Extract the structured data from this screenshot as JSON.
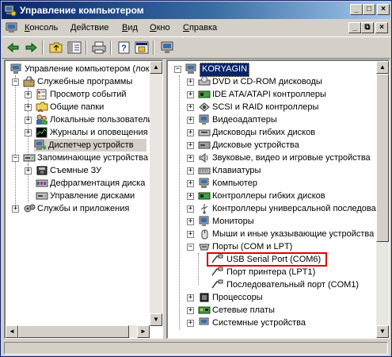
{
  "window": {
    "title": "Управление компьютером",
    "controls": {
      "minimize": "_",
      "maximize": "□",
      "close": "×"
    }
  },
  "menu": {
    "items": [
      {
        "label": "Консоль",
        "underline": "К",
        "rest": "онсоль"
      },
      {
        "label": "Действие",
        "underline": "Д",
        "rest": "ействие"
      },
      {
        "label": "Вид",
        "underline": "В",
        "rest": "ид"
      },
      {
        "label": "Окно",
        "underline": "О",
        "rest": "кно"
      },
      {
        "label": "Справка",
        "underline": "С",
        "rest": "правка"
      }
    ],
    "mdi_controls": {
      "minimize": "_",
      "restore": "⧉",
      "close": "×"
    }
  },
  "toolbar": {
    "buttons": [
      "back-icon",
      "forward-icon",
      "up-folder-icon",
      "show-tree-icon",
      "print-icon",
      "help-icon",
      "properties-icon",
      "monitor-icon"
    ]
  },
  "left_tree": {
    "root": "Управление компьютером (локаль",
    "items": [
      {
        "label": "Служебные программы",
        "expander": "−"
      },
      {
        "label": "Просмотр событий",
        "expander": "+"
      },
      {
        "label": "Общие папки",
        "expander": "+"
      },
      {
        "label": "Локальные пользователи",
        "expander": "+"
      },
      {
        "label": "Журналы и оповещения пр",
        "expander": "+"
      },
      {
        "label": "Диспетчер устройств",
        "expander": ""
      },
      {
        "label": "Запоминающие устройства",
        "expander": "−"
      },
      {
        "label": "Съемные ЗУ",
        "expander": "+"
      },
      {
        "label": "Дефрагментация диска",
        "expander": ""
      },
      {
        "label": "Управление дисками",
        "expander": ""
      },
      {
        "label": "Службы и приложения",
        "expander": "+"
      }
    ]
  },
  "right_tree": {
    "root": "KORYAGIN",
    "root_expander": "−",
    "items": [
      {
        "label": "DVD и CD-ROM дисководы",
        "expander": "+"
      },
      {
        "label": "IDE ATA/ATAPI контроллеры",
        "expander": "+"
      },
      {
        "label": "SCSI и RAID контроллеры",
        "expander": "+"
      },
      {
        "label": "Видеоадаптеры",
        "expander": "+"
      },
      {
        "label": "Дисководы гибких дисков",
        "expander": "+"
      },
      {
        "label": "Дисковые устройства",
        "expander": "+"
      },
      {
        "label": "Звуковые, видео и игровые устройства",
        "expander": "+"
      },
      {
        "label": "Клавиатуры",
        "expander": "+"
      },
      {
        "label": "Компьютер",
        "expander": "+"
      },
      {
        "label": "Контроллеры гибких дисков",
        "expander": "+"
      },
      {
        "label": "Контроллеры универсальной последова",
        "expander": "+"
      },
      {
        "label": "Мониторы",
        "expander": "+"
      },
      {
        "label": "Мыши и иные указывающие устройства",
        "expander": "+"
      },
      {
        "label": "Порты (COM и LPT)",
        "expander": "−"
      },
      {
        "label": "USB Serial Port (COM6)",
        "expander": ""
      },
      {
        "label": "Порт принтера (LPT1)",
        "expander": ""
      },
      {
        "label": "Последовательный порт (COM1)",
        "expander": ""
      },
      {
        "label": "Процессоры",
        "expander": "+"
      },
      {
        "label": "Сетевые платы",
        "expander": "+"
      },
      {
        "label": "Системные устройства",
        "expander": "+"
      }
    ]
  },
  "scroll": {
    "up_arrow": "▲",
    "down_arrow": "▼",
    "left_arrow": "◄",
    "right_arrow": "►"
  },
  "colors": {
    "title_start": "#0a246a",
    "title_end": "#a6caf0",
    "highlight_border": "#e00000",
    "face": "#d4d0c8"
  }
}
